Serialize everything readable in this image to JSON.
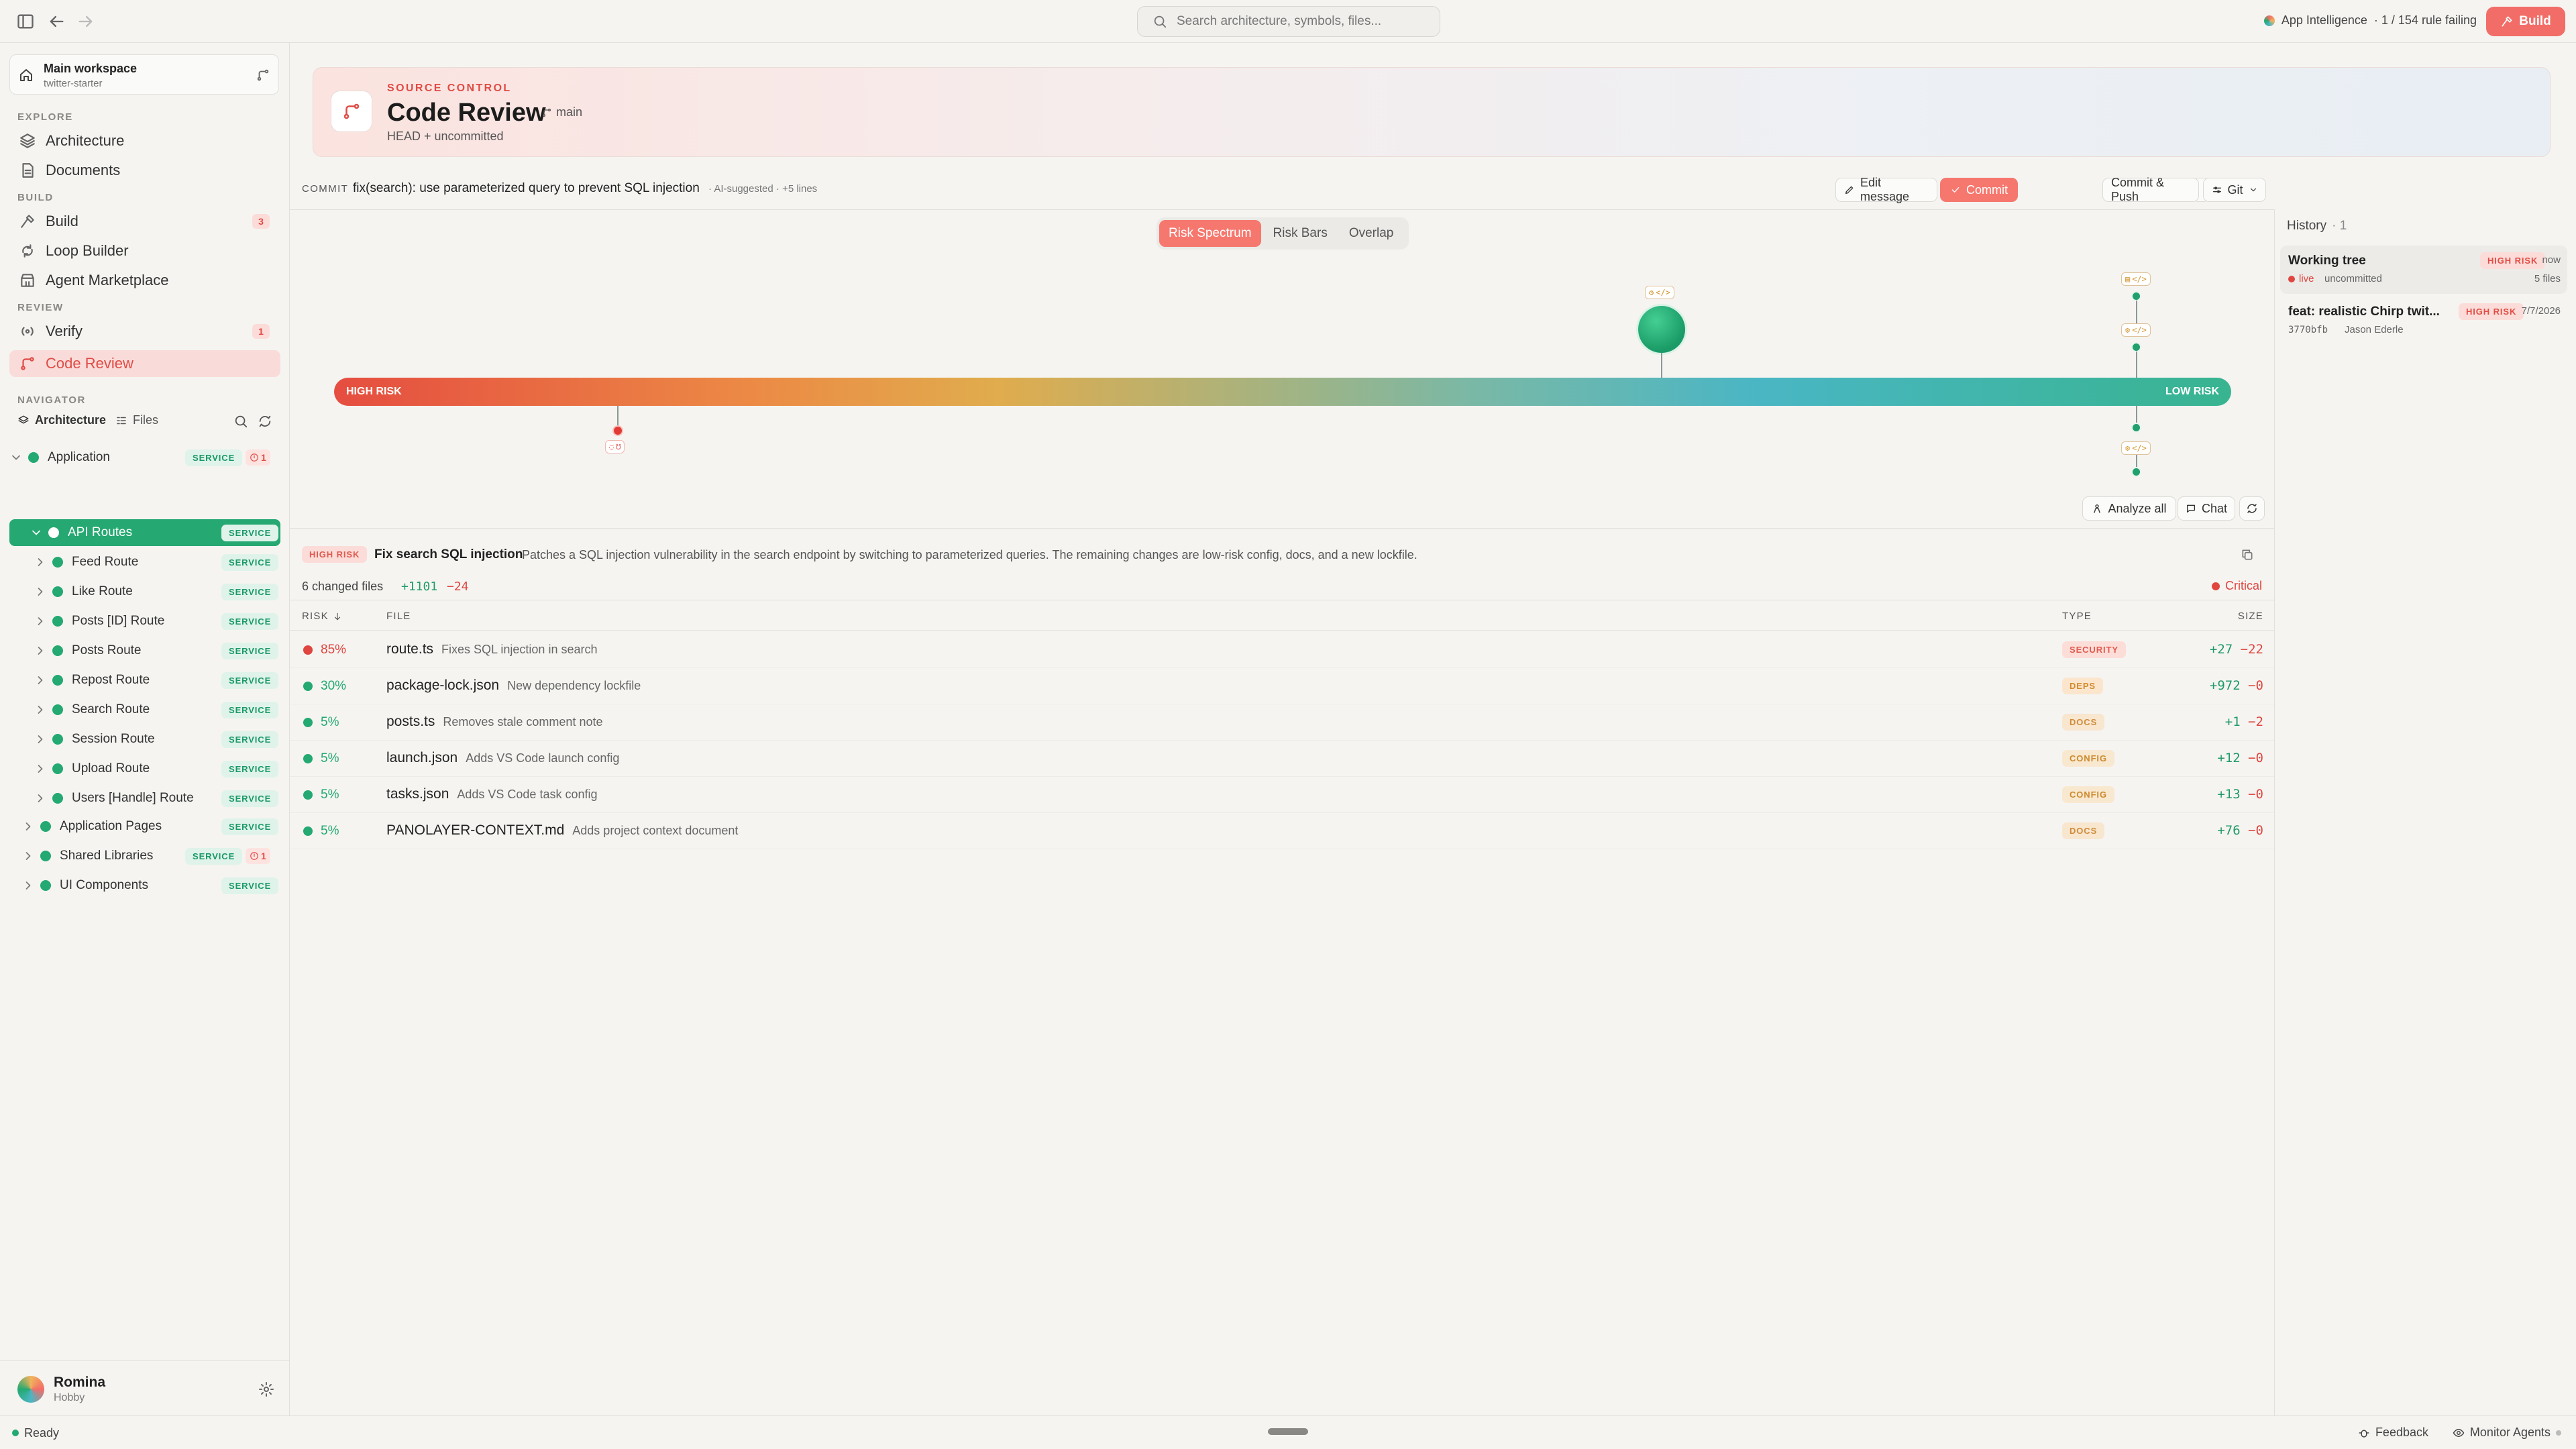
{
  "topbar": {
    "search_placeholder": "Search architecture, symbols, files...",
    "app_intelligence": "App Intelligence",
    "rule_status": "· 1 / 154 rule failing",
    "build_label": "Build"
  },
  "workspace": {
    "name": "Main workspace",
    "project": "twitter-starter"
  },
  "sidebar": {
    "explore_label": "EXPLORE",
    "build_section_label": "BUILD",
    "review_label": "REVIEW",
    "navigator_label": "NAVIGATOR",
    "items": {
      "architecture": "Architecture",
      "documents": "Documents",
      "build": "Build",
      "build_count": "3",
      "loop_builder": "Loop Builder",
      "agent_marketplace": "Agent Marketplace",
      "verify": "Verify",
      "verify_count": "1",
      "code_review": "Code Review"
    },
    "nav_tabs": {
      "architecture": "Architecture",
      "files": "Files"
    },
    "service_badge": "SERVICE",
    "tree": {
      "application": "Application",
      "application_err": "1",
      "api_routes": "API Routes",
      "routes": [
        "Feed Route",
        "Like Route",
        "Posts [ID] Route",
        "Posts Route",
        "Repost Route",
        "Search Route",
        "Session Route",
        "Upload Route",
        "Users [Handle] Route"
      ],
      "application_pages": "Application Pages",
      "shared_libraries": "Shared Libraries",
      "shared_err": "1",
      "ui_components": "UI Components"
    },
    "user": {
      "name": "Romina",
      "plan": "Hobby"
    }
  },
  "header": {
    "eyebrow": "SOURCE CONTROL",
    "title": "Code Review",
    "branch": "main",
    "subtitle": "HEAD + uncommitted"
  },
  "commit": {
    "label": "COMMIT",
    "message": "fix(search): use parameterized query to prevent SQL injection",
    "ai_note": "· AI-suggested · +5 lines",
    "edit_label": "Edit message",
    "commit_label": "Commit",
    "commit_push_label": "Commit & Push",
    "git_label": "Git"
  },
  "spectrum": {
    "tabs": [
      "Risk Spectrum",
      "Risk Bars",
      "Overlap"
    ],
    "active_tab": "Risk Spectrum",
    "high_label": "HIGH RISK",
    "low_label": "LOW RISK",
    "analyze_label": "Analyze all",
    "chat_label": "Chat"
  },
  "summary": {
    "badge": "HIGH RISK",
    "title": "Fix search SQL injection",
    "text": "Patches a SQL injection vulnerability in the search endpoint by switching to parameterized queries. The remaining changes are low-risk config, docs, and a new lockfile."
  },
  "changes": {
    "count_label": "6 changed files",
    "additions": "+1101",
    "deletions": "−24",
    "severity": "Critical"
  },
  "columns": {
    "risk": "RISK",
    "file": "FILE",
    "type": "TYPE",
    "size": "SIZE"
  },
  "files": [
    {
      "risk": "85%",
      "level": "critical",
      "name": "route.ts",
      "desc": "Fixes SQL injection in search",
      "type": "SECURITY",
      "add": "+27",
      "del": "−22"
    },
    {
      "risk": "30%",
      "level": "low",
      "name": "package-lock.json",
      "desc": "New dependency lockfile",
      "type": "DEPS",
      "add": "+972",
      "del": "−0"
    },
    {
      "risk": "5%",
      "level": "low",
      "name": "posts.ts",
      "desc": "Removes stale comment note",
      "type": "DOCS",
      "add": "+1",
      "del": "−2"
    },
    {
      "risk": "5%",
      "level": "low",
      "name": "launch.json",
      "desc": "Adds VS Code launch config",
      "type": "CONFIG",
      "add": "+12",
      "del": "−0"
    },
    {
      "risk": "5%",
      "level": "low",
      "name": "tasks.json",
      "desc": "Adds VS Code task config",
      "type": "CONFIG",
      "add": "+13",
      "del": "−0"
    },
    {
      "risk": "5%",
      "level": "low",
      "name": "PANOLAYER-CONTEXT.md",
      "desc": "Adds project context document",
      "type": "DOCS",
      "add": "+76",
      "del": "−0"
    }
  ],
  "history": {
    "title": "History",
    "count": "· 1",
    "items": [
      {
        "title": "Working tree",
        "risk": "HIGH RISK",
        "when": "now",
        "status": "live",
        "meta": "uncommitted",
        "files": "5 files"
      },
      {
        "title": "feat: realistic Chirp twit...",
        "risk": "HIGH RISK",
        "when": "7/7/2026",
        "hash": "3770bfb",
        "author": "Jason Ederle"
      }
    ]
  },
  "status": {
    "ready": "Ready",
    "feedback": "Feedback",
    "monitor": "Monitor Agents"
  },
  "colors": {
    "accent": "#f26d67",
    "green": "#23a971",
    "red": "#e0453f"
  }
}
